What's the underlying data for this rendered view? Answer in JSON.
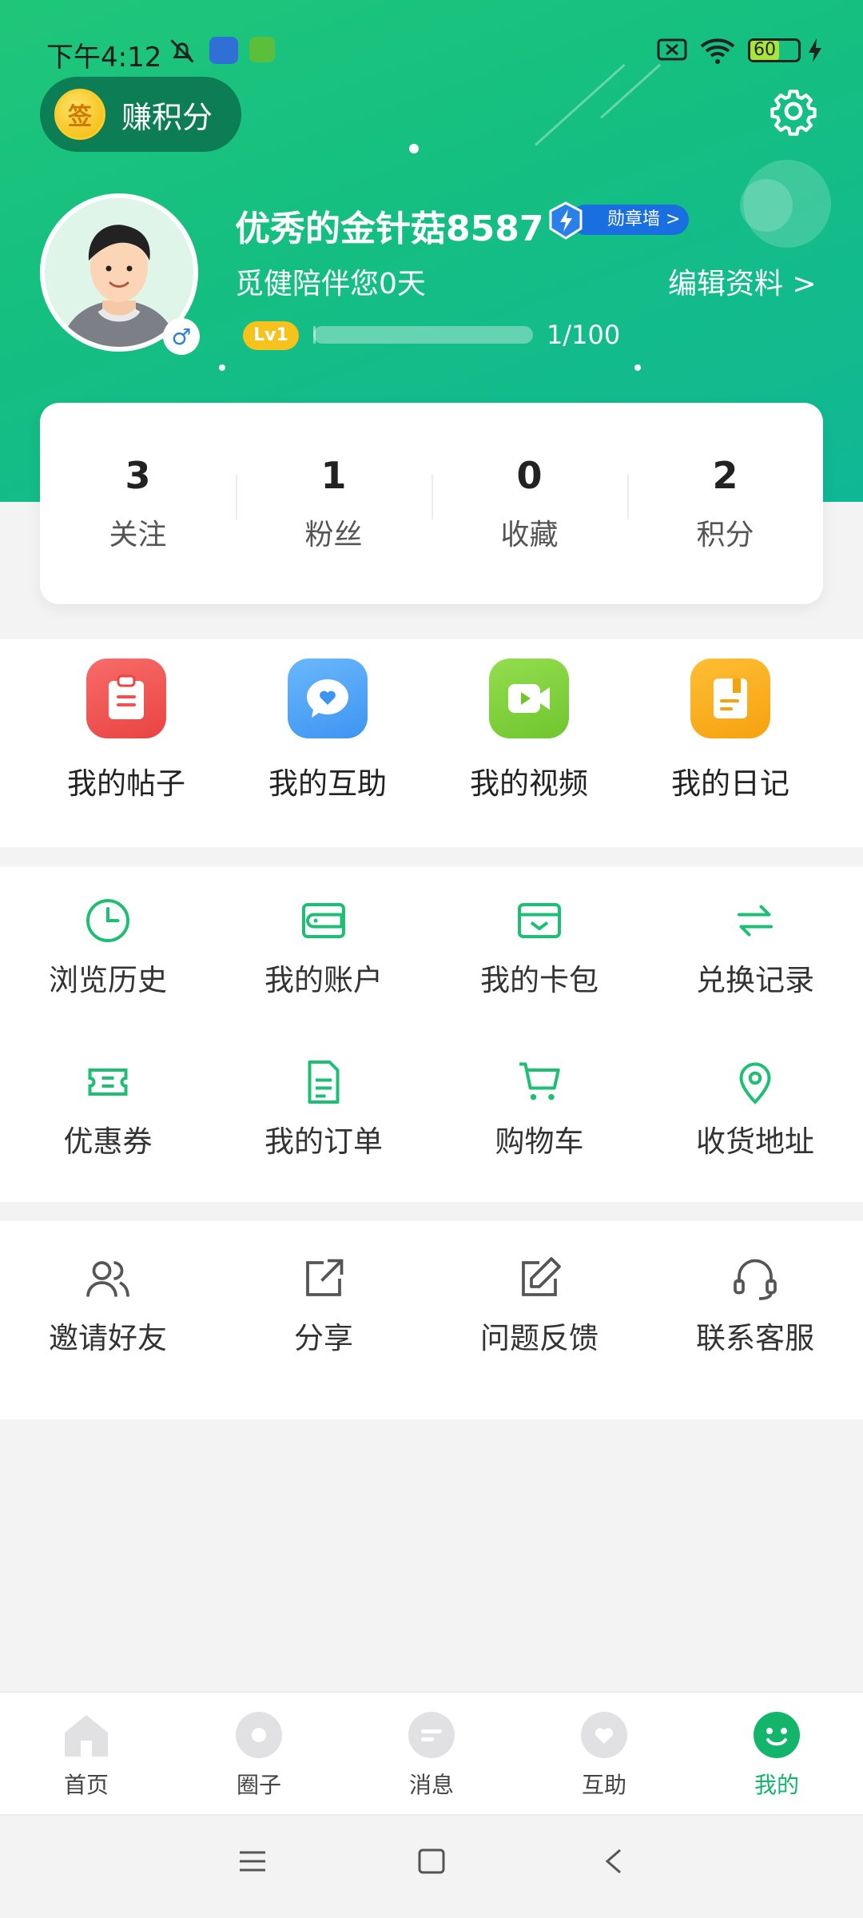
{
  "status_bar": {
    "time": "下午4:12",
    "battery": "60"
  },
  "header": {
    "earn_points_label": "赚积分",
    "coin_glyph": "签",
    "username": "优秀的金针菇8587",
    "medal_label": "勋章墙 >",
    "subtitle": "觅健陪伴您0天",
    "edit_label": "编辑资料 >",
    "level_badge": "Lv1",
    "level_progress_text": "1/100",
    "level_progress_fraction": 0.01,
    "gender_glyph": "♂"
  },
  "stats": [
    {
      "value": "3",
      "label": "关注"
    },
    {
      "value": "1",
      "label": "粉丝"
    },
    {
      "value": "0",
      "label": "收藏"
    },
    {
      "value": "2",
      "label": "积分"
    }
  ],
  "quick_actions": [
    {
      "label": "我的帖子",
      "icon": "posts-icon",
      "color": "#f0524f"
    },
    {
      "label": "我的互助",
      "icon": "help-icon",
      "color": "#4da3f7"
    },
    {
      "label": "我的视频",
      "icon": "video-icon",
      "color": "#7ed13d"
    },
    {
      "label": "我的日记",
      "icon": "diary-icon",
      "color": "#f8ad1c"
    }
  ],
  "services": [
    {
      "label": "浏览历史",
      "icon": "clock-icon"
    },
    {
      "label": "我的账户",
      "icon": "wallet-icon"
    },
    {
      "label": "我的卡包",
      "icon": "card-wallet-icon"
    },
    {
      "label": "兑换记录",
      "icon": "exchange-icon"
    },
    {
      "label": "优惠券",
      "icon": "coupon-icon"
    },
    {
      "label": "我的订单",
      "icon": "order-icon"
    },
    {
      "label": "购物车",
      "icon": "cart-icon"
    },
    {
      "label": "收货地址",
      "icon": "location-icon"
    }
  ],
  "more": [
    {
      "label": "邀请好友",
      "icon": "invite-icon"
    },
    {
      "label": "分享",
      "icon": "share-icon"
    },
    {
      "label": "问题反馈",
      "icon": "feedback-icon"
    },
    {
      "label": "联系客服",
      "icon": "headset-icon"
    }
  ],
  "tabs": [
    {
      "label": "首页",
      "icon": "home-icon"
    },
    {
      "label": "圈子",
      "icon": "circle-icon"
    },
    {
      "label": "消息",
      "icon": "message-icon"
    },
    {
      "label": "互助",
      "icon": "heart-icon"
    },
    {
      "label": "我的",
      "icon": "me-icon",
      "active": true
    }
  ],
  "colors": {
    "accent": "#13b56b",
    "icon_green": "#1cbf74"
  }
}
